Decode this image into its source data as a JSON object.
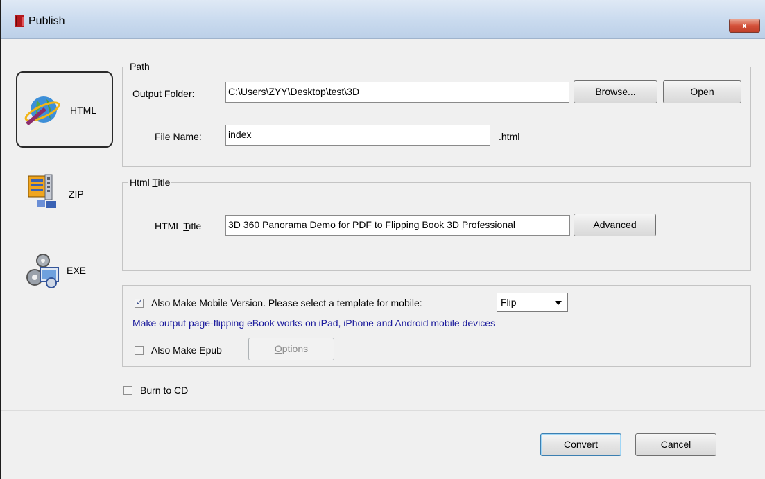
{
  "window": {
    "title": "Publish",
    "close_label": "x"
  },
  "nav": {
    "items": [
      {
        "label": "HTML",
        "icon": "globe-icon",
        "selected": true
      },
      {
        "label": "ZIP",
        "icon": "zip-archive-icon",
        "selected": false
      },
      {
        "label": "EXE",
        "icon": "exe-gears-icon",
        "selected": false
      }
    ]
  },
  "path": {
    "legend": "Path",
    "output_folder_label": "Output Folder:",
    "output_folder_value": "C:\\Users\\ZYY\\Desktop\\test\\3D",
    "browse_label": "Browse...",
    "open_label": "Open",
    "file_name_label": "File Name:",
    "file_name_value": "index",
    "file_ext": ".html"
  },
  "html_title": {
    "legend": "Html Title",
    "label": "HTML Title",
    "value": "3D 360 Panorama Demo for PDF to Flipping Book 3D Professional",
    "advanced_label": "Advanced"
  },
  "mobile": {
    "checkbox_label": "Also Make Mobile Version. Please select a template for mobile:",
    "checked": true,
    "template_value": "Flip",
    "hint": "Make output page-flipping eBook works on iPad, iPhone and Android mobile devices",
    "epub_label": "Also Make Epub",
    "epub_checked": false,
    "options_label": "Options"
  },
  "burn": {
    "label": "Burn to CD",
    "checked": false
  },
  "actions": {
    "convert_label": "Convert",
    "cancel_label": "Cancel"
  },
  "colors": {
    "hint_text": "#1a1a9c",
    "titlebar": "#c9daee",
    "close_button": "#d4513a"
  }
}
